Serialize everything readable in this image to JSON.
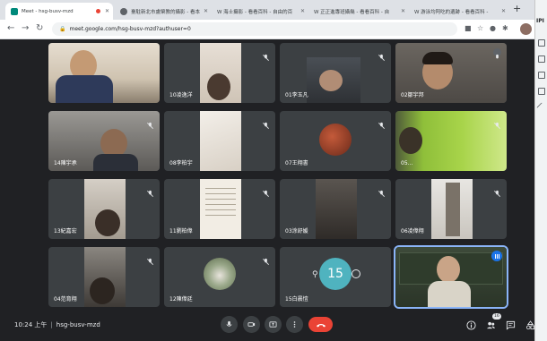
{
  "browser": {
    "tabs": [
      {
        "label": "Meet - hsg-busv-mzd",
        "active": true,
        "recording_dot": true
      },
      {
        "label": "臺駐新北市盧榮教的攝影 - 看本",
        "active": false
      },
      {
        "label": "W  海士攝影 - 看看百科 - 自由的百",
        "active": false
      },
      {
        "label": "W  正正進專班攝幾 - 看看百科 - 自",
        "active": false
      },
      {
        "label": "W  游泳均阿吃的遺跡 - 看看百科 -",
        "active": false
      }
    ],
    "url": "meet.google.com/hsg-busv-mzd?authuser=0",
    "side_label": "IPI"
  },
  "meet": {
    "meeting_time": "10:24 上午",
    "meeting_code": "hsg-busv-mzd",
    "participant_count": "16",
    "participants": [
      {
        "name": "",
        "style": "boy-desk"
      },
      {
        "name": "10凌逸洋",
        "style": "wall"
      },
      {
        "name": "01李玉凡",
        "style": "room"
      },
      {
        "name": "02鄒宇邦",
        "style": "boy-close"
      },
      {
        "name": "14陳宇承",
        "style": "boy-room"
      },
      {
        "name": "08李柏宇",
        "style": "ceiling"
      },
      {
        "name": "07王翔書",
        "style": "avatar-food"
      },
      {
        "name": "05...",
        "style": "green"
      },
      {
        "name": "13紀嘉宏",
        "style": "door"
      },
      {
        "name": "11劉柏偉",
        "style": "paper"
      },
      {
        "name": "03涂舒媛",
        "style": "dark-room"
      },
      {
        "name": "06凌偉翔",
        "style": "light-room"
      },
      {
        "name": "04范育翔",
        "style": "dark-door"
      },
      {
        "name": "12陳偉廷",
        "style": "avatar-plate"
      },
      {
        "name": "15白晨愷",
        "style": "avatar-clock"
      },
      {
        "name": "",
        "style": "teacher"
      }
    ],
    "clock_avatar_text": "15"
  },
  "colors": {
    "background": "#202124",
    "tile": "#3c4043",
    "leave_red": "#ea4335",
    "speaking_blue": "#1a73e8"
  }
}
